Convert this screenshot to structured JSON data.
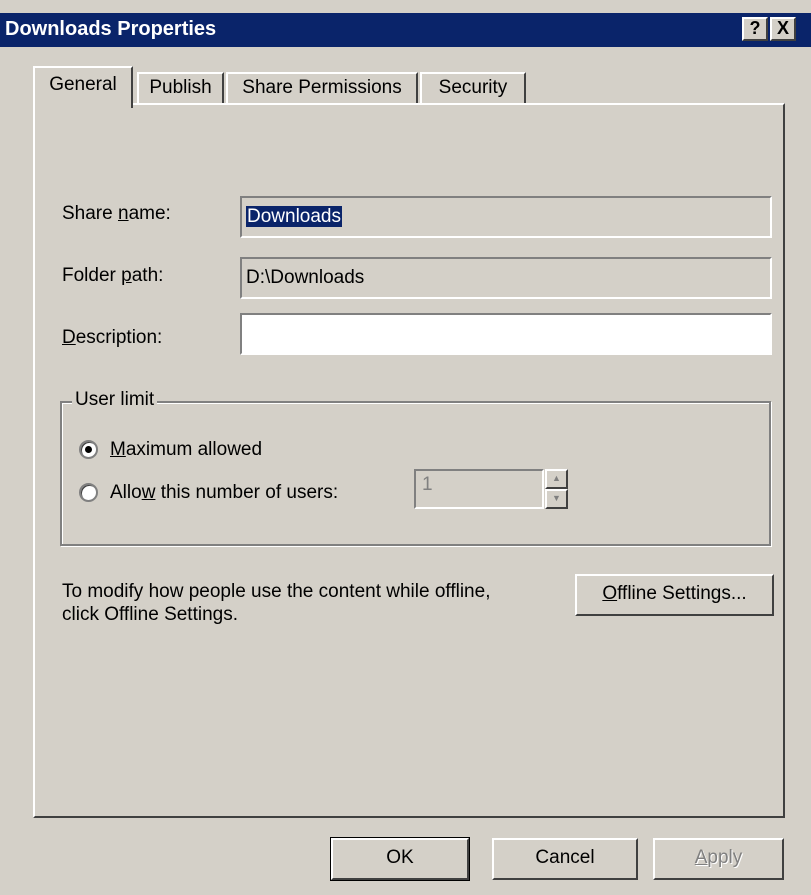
{
  "window": {
    "title": "Downloads Properties",
    "help_glyph": "?",
    "close_glyph": "X"
  },
  "tabs": [
    {
      "label": "General",
      "active": true
    },
    {
      "label": "Publish",
      "active": false
    },
    {
      "label": "Share Permissions",
      "active": false
    },
    {
      "label": "Security",
      "active": false
    }
  ],
  "general": {
    "share_name": {
      "label_pre": "Share ",
      "label_key": "n",
      "label_post": "ame:",
      "value": "Downloads"
    },
    "folder_path": {
      "label_pre": "Folder ",
      "label_key": "p",
      "label_post": "ath:",
      "value": "D:\\Downloads"
    },
    "description": {
      "label_pre": "",
      "label_key": "D",
      "label_post": "escription:",
      "value": ""
    },
    "user_limit": {
      "legend": "User limit",
      "maximum": {
        "pre": "",
        "key": "M",
        "post": "aximum allowed",
        "checked": true
      },
      "allow": {
        "pre": "Allo",
        "key": "w",
        "post": " this number of users:",
        "checked": false
      },
      "count_value": "1"
    },
    "offline_text_line1": "To modify how people use the content while offline,",
    "offline_text_line2": "click Offline Settings.",
    "offline_button": {
      "pre": "",
      "key": "O",
      "post": "ffline Settings..."
    }
  },
  "buttons": {
    "ok": "OK",
    "cancel": "Cancel",
    "apply": {
      "pre": "",
      "key": "A",
      "post": "pply"
    }
  },
  "colors": {
    "titlebar": "#0a246a",
    "dialog_face": "#d4d0c8",
    "selection": "#0a246a"
  }
}
